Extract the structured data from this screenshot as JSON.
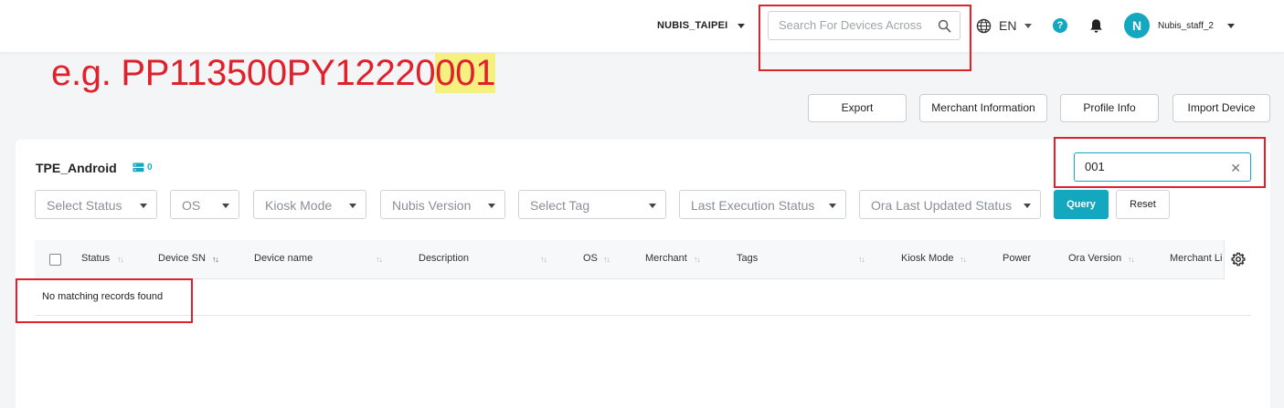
{
  "header": {
    "tenant": "NUBIS_TAIPEI",
    "search_placeholder": "Search For Devices Across",
    "language": "EN",
    "help_glyph": "?",
    "avatar_initial": "N",
    "username": "Nubis_staff_2",
    "icons": [
      "search-icon",
      "globe-icon",
      "help-icon",
      "bell-icon",
      "chevron-down-icon"
    ]
  },
  "annotation": {
    "prefix": "e.g. PP113500PY12220",
    "highlight": "001",
    "highlight_color": "#f5f080",
    "color": "#e0212b"
  },
  "actions": {
    "export": "Export",
    "merchant_info": "Merchant Information",
    "profile_info": "Profile Info",
    "import_device": "Import Device"
  },
  "group": {
    "title": "TPE_Android",
    "device_count": "0"
  },
  "table_search": {
    "value": "001"
  },
  "filters": {
    "status": "Select Status",
    "os": "OS",
    "kiosk_mode": "Kiosk Mode",
    "nubis_version": "Nubis Version",
    "tag": "Select Tag",
    "last_execution_status": "Last Execution Status",
    "ora_last_updated_status": "Ora Last Updated Status",
    "query": "Query",
    "reset": "Reset"
  },
  "table": {
    "columns": {
      "status": "Status",
      "device_sn": "Device SN",
      "device_name": "Device name",
      "description": "Description",
      "os": "OS",
      "merchant": "Merchant",
      "tags": "Tags",
      "kiosk_mode": "Kiosk Mode",
      "power": "Power",
      "ora_version": "Ora Version",
      "merchant_li": "Merchant Li"
    },
    "empty_message": "No matching records found"
  },
  "theme": {
    "accent": "#13a7c0",
    "annotation_red": "#e0212b"
  }
}
